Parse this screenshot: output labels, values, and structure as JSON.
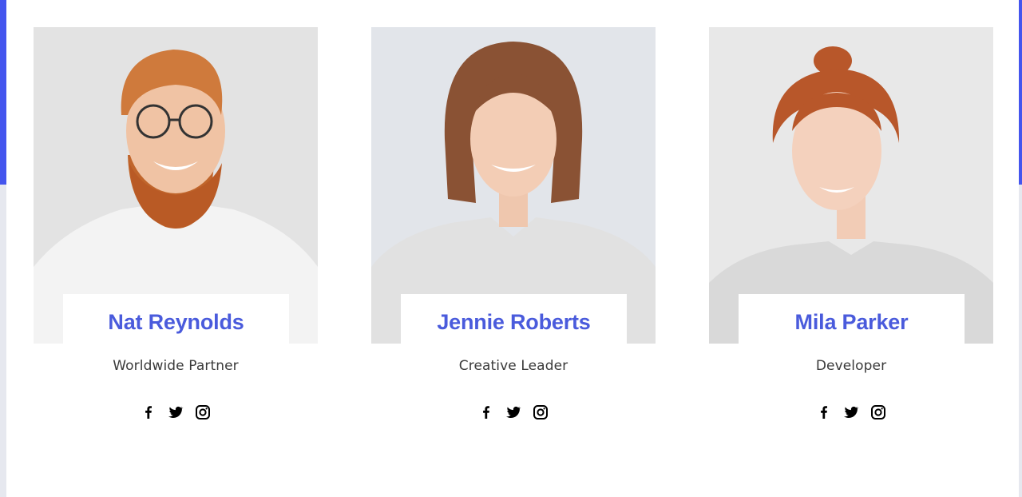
{
  "team": [
    {
      "name": "Nat Reynolds",
      "role": "Worldwide Partner"
    },
    {
      "name": "Jennie Roberts",
      "role": "Creative Leader"
    },
    {
      "name": "Mila Parker",
      "role": "Developer"
    }
  ],
  "social_icons": [
    "facebook-icon",
    "twitter-icon",
    "instagram-icon"
  ],
  "colors": {
    "accent": "#4a5bdc",
    "edge_accent": "#4455ee",
    "role_text": "#3a3a3a"
  }
}
